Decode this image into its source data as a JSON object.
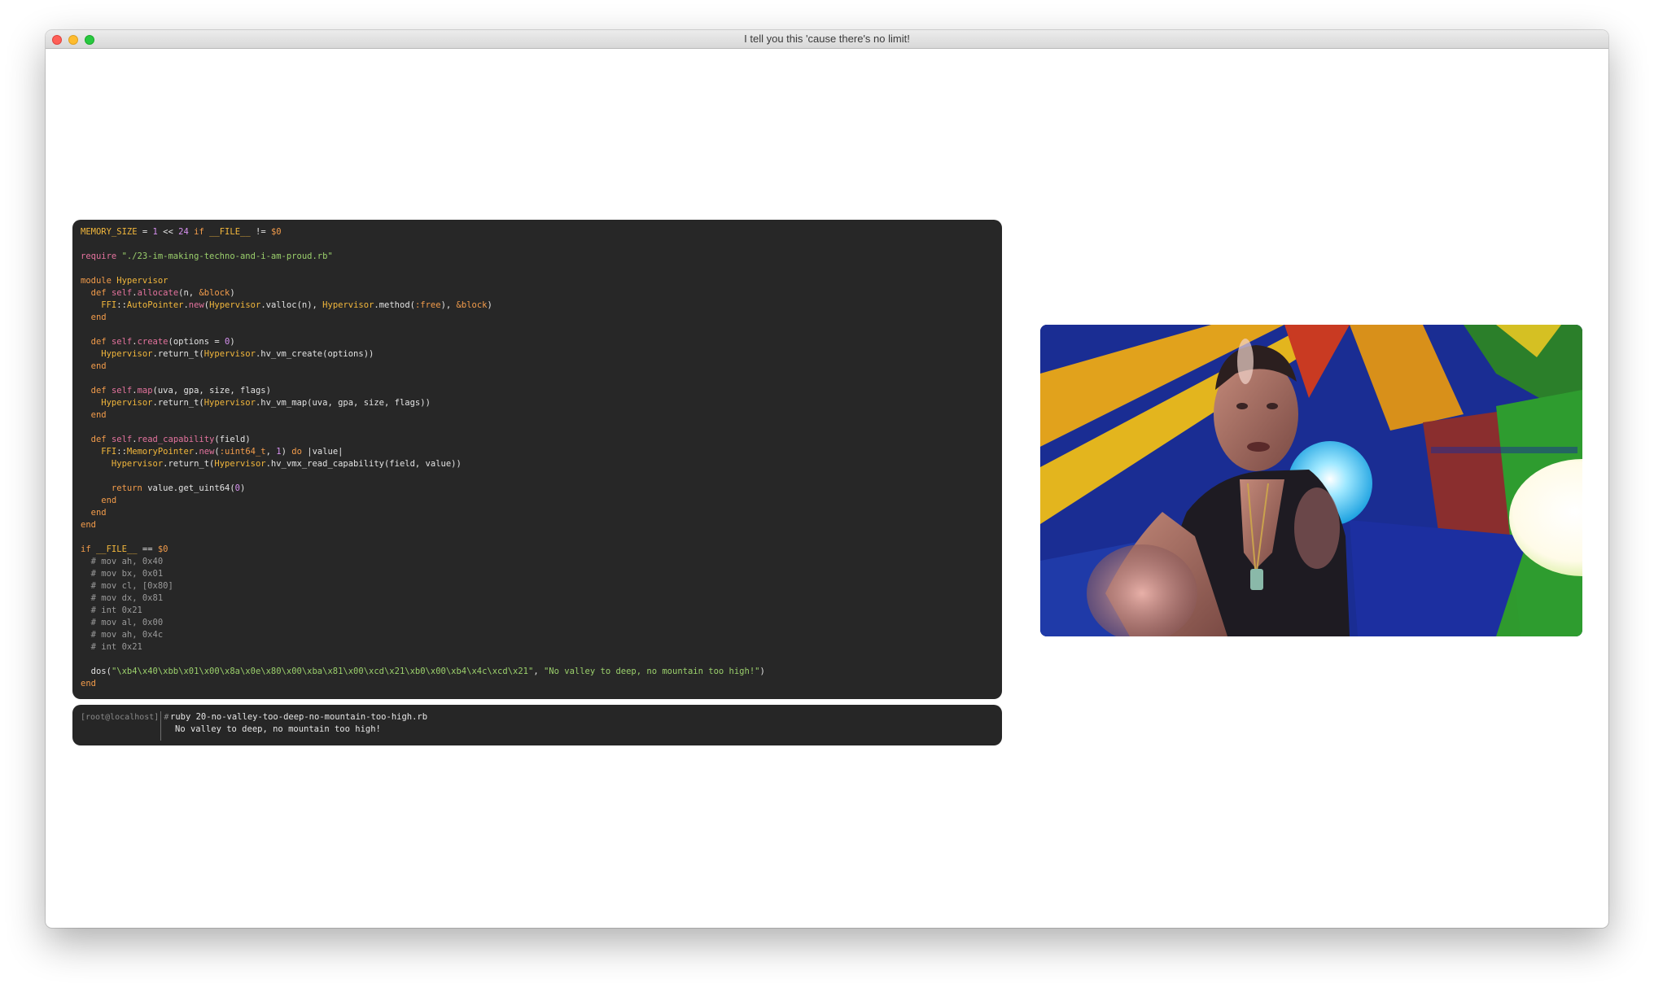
{
  "window": {
    "title": "I tell you this 'cause there's no limit!"
  },
  "code": {
    "lines": [
      [
        [
          "MEMORY_SIZE",
          "con"
        ],
        [
          " = ",
          ""
        ],
        [
          "1",
          "num"
        ],
        [
          " << ",
          ""
        ],
        [
          "24",
          "num"
        ],
        [
          " if ",
          "kw"
        ],
        [
          "__FILE__",
          "con"
        ],
        [
          " != ",
          ""
        ],
        [
          "$0",
          "sym"
        ]
      ],
      [],
      [
        [
          "require ",
          "fn"
        ],
        [
          "\"./23-im-making-techno-and-i-am-proud.rb\"",
          "str"
        ]
      ],
      [],
      [
        [
          "module ",
          "kw"
        ],
        [
          "Hypervisor",
          "con"
        ]
      ],
      [
        [
          "  def ",
          "kw"
        ],
        [
          "self",
          "fn"
        ],
        [
          ".",
          ""
        ],
        [
          "allocate",
          "fn"
        ],
        [
          "(n, ",
          ""
        ],
        [
          "&block",
          "sym"
        ],
        [
          ")",
          ""
        ]
      ],
      [
        [
          "    FFI",
          "con"
        ],
        [
          "::",
          ""
        ],
        [
          "AutoPointer",
          "con"
        ],
        [
          ".",
          ""
        ],
        [
          "new",
          "fn"
        ],
        [
          "(",
          ""
        ],
        [
          "Hypervisor",
          "con"
        ],
        [
          ".valloc(n), ",
          ""
        ],
        [
          "Hypervisor",
          "con"
        ],
        [
          ".method(",
          ""
        ],
        [
          ":free",
          "sym"
        ],
        [
          "), ",
          ""
        ],
        [
          "&block",
          "sym"
        ],
        [
          ")",
          ""
        ]
      ],
      [
        [
          "  end",
          "kw"
        ]
      ],
      [],
      [
        [
          "  def ",
          "kw"
        ],
        [
          "self",
          "fn"
        ],
        [
          ".",
          ""
        ],
        [
          "create",
          "fn"
        ],
        [
          "(options = ",
          ""
        ],
        [
          "0",
          "num"
        ],
        [
          ")",
          ""
        ]
      ],
      [
        [
          "    Hypervisor",
          "con"
        ],
        [
          ".return_t(",
          ""
        ],
        [
          "Hypervisor",
          "con"
        ],
        [
          ".hv_vm_create(options))",
          ""
        ]
      ],
      [
        [
          "  end",
          "kw"
        ]
      ],
      [],
      [
        [
          "  def ",
          "kw"
        ],
        [
          "self",
          "fn"
        ],
        [
          ".",
          ""
        ],
        [
          "map",
          "fn"
        ],
        [
          "(uva, gpa, size, flags)",
          ""
        ]
      ],
      [
        [
          "    Hypervisor",
          "con"
        ],
        [
          ".return_t(",
          ""
        ],
        [
          "Hypervisor",
          "con"
        ],
        [
          ".hv_vm_map(uva, gpa, size, flags))",
          ""
        ]
      ],
      [
        [
          "  end",
          "kw"
        ]
      ],
      [],
      [
        [
          "  def ",
          "kw"
        ],
        [
          "self",
          "fn"
        ],
        [
          ".",
          ""
        ],
        [
          "read_capability",
          "fn"
        ],
        [
          "(field)",
          ""
        ]
      ],
      [
        [
          "    FFI",
          "con"
        ],
        [
          "::",
          ""
        ],
        [
          "MemoryPointer",
          "con"
        ],
        [
          ".",
          ""
        ],
        [
          "new",
          "fn"
        ],
        [
          "(",
          ""
        ],
        [
          ":uint64_t",
          "sym"
        ],
        [
          ", ",
          ""
        ],
        [
          "1",
          "num"
        ],
        [
          ") ",
          ""
        ],
        [
          "do ",
          "kw"
        ],
        [
          "|value|",
          ""
        ]
      ],
      [
        [
          "      Hypervisor",
          "con"
        ],
        [
          ".return_t(",
          ""
        ],
        [
          "Hypervisor",
          "con"
        ],
        [
          ".hv_vmx_read_capability(field, value))",
          ""
        ]
      ],
      [],
      [
        [
          "      return ",
          "kw"
        ],
        [
          "value.get_uint64(",
          ""
        ],
        [
          "0",
          "num"
        ],
        [
          ")",
          ""
        ]
      ],
      [
        [
          "    end",
          "kw"
        ]
      ],
      [
        [
          "  end",
          "kw"
        ]
      ],
      [
        [
          "end",
          "kw"
        ]
      ],
      [],
      [
        [
          "if ",
          "kw"
        ],
        [
          "__FILE__",
          "con"
        ],
        [
          " == ",
          ""
        ],
        [
          "$0",
          "sym"
        ]
      ],
      [
        [
          "  # mov ah, 0x40",
          "cmt"
        ]
      ],
      [
        [
          "  # mov bx, 0x01",
          "cmt"
        ]
      ],
      [
        [
          "  # mov cl, [0x80]",
          "cmt"
        ]
      ],
      [
        [
          "  # mov dx, 0x81",
          "cmt"
        ]
      ],
      [
        [
          "  # int 0x21",
          "cmt"
        ]
      ],
      [
        [
          "  # mov al, 0x00",
          "cmt"
        ]
      ],
      [
        [
          "  # mov ah, 0x4c",
          "cmt"
        ]
      ],
      [
        [
          "  # int 0x21",
          "cmt"
        ]
      ],
      [],
      [
        [
          "  dos(",
          ""
        ],
        [
          "\"\\xb4\\x40\\xbb\\x01\\x00\\x8a\\x0e\\x80\\x00\\xba\\x81\\x00\\xcd\\x21\\xb0\\x00\\xb4\\x4c\\xcd\\x21\"",
          "str"
        ],
        [
          ", ",
          ""
        ],
        [
          "\"No valley to deep, no mountain too high!\"",
          "str"
        ],
        [
          ")",
          ""
        ]
      ],
      [
        [
          "end",
          "kw"
        ]
      ]
    ]
  },
  "terminal": {
    "prompt": "[root@localhost] #",
    "command": "ruby 20-no-valley-too-deep-no-mountain-too-high.rb",
    "output": "No valley to deep, no mountain too high!"
  },
  "video": {
    "description_icon": "video-frame"
  }
}
